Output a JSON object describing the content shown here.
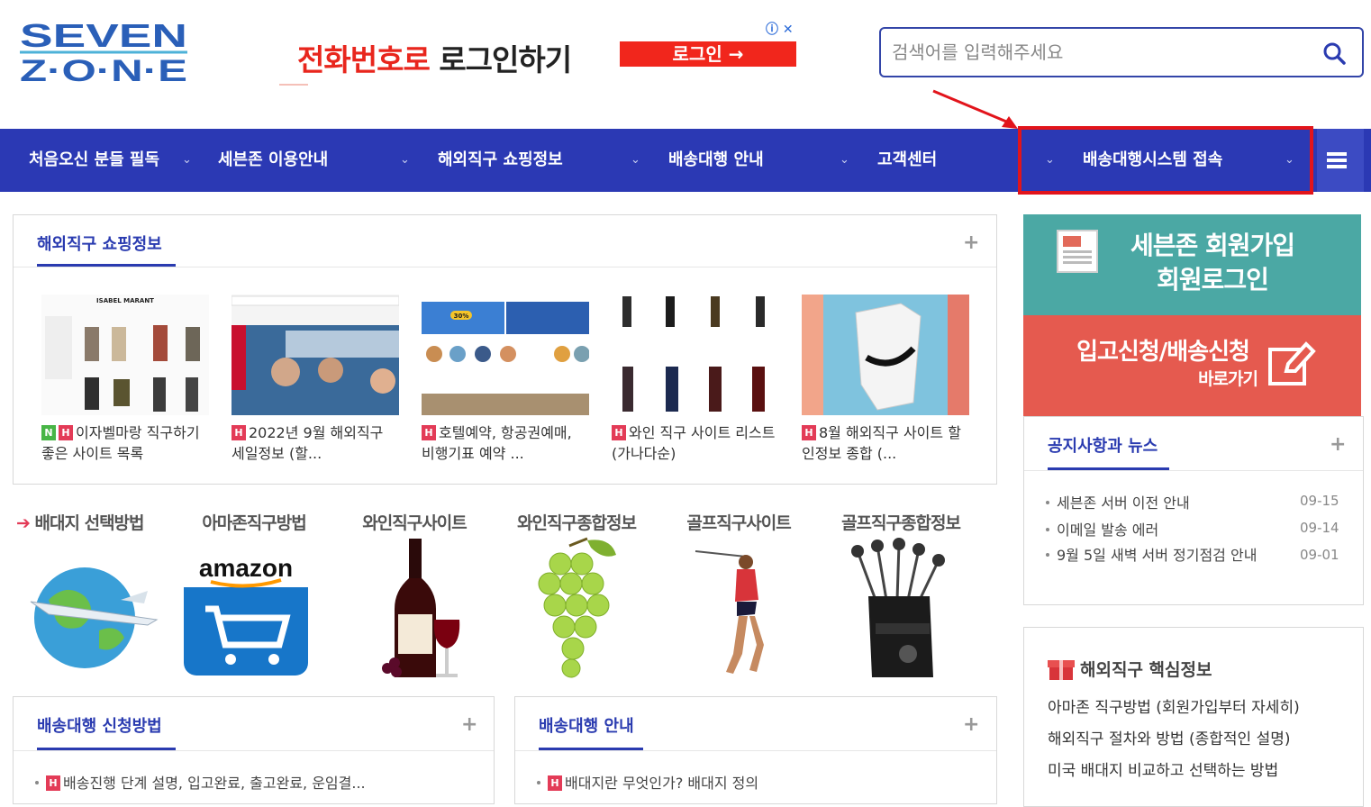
{
  "header": {
    "logo_top": "SEVEN",
    "logo_bottom": "Z·O·N·E",
    "ad_text_red": "전화번호로",
    "ad_text_dark": "로그인하기",
    "ad_button": "로그인 →",
    "search_placeholder": "검색어를 입력해주세요"
  },
  "nav": {
    "items": [
      {
        "label": "처음오신 분들 필독"
      },
      {
        "label": "세븐존 이용안내"
      },
      {
        "label": "해외직구 쇼핑정보"
      },
      {
        "label": "배송대행 안내"
      },
      {
        "label": "고객센터"
      },
      {
        "label": "배송대행시스템 접속"
      }
    ],
    "caret": "⌄",
    "colors": {
      "bar": "#2b39b4",
      "highlight": "#e2141b"
    }
  },
  "shopping": {
    "title": "해외직구 쇼핑정보",
    "plus": "+",
    "posts": [
      {
        "badges": [
          "N",
          "H"
        ],
        "caption": "이자벨마랑 직구하기 좋은 사이트 목록",
        "thumb_label": "ISABEL MARANT"
      },
      {
        "badges": [
          "H"
        ],
        "caption": "2022년 9월 해외직구 세일정보 (할...",
        "thumb_label": ""
      },
      {
        "badges": [
          "H"
        ],
        "caption": "호텔예약, 항공권예매, 비행기표 예약 ...",
        "thumb_label": "30%"
      },
      {
        "badges": [
          "H"
        ],
        "caption": "와인 직구 사이트 리스트 (가나다순)",
        "thumb_label": ""
      },
      {
        "badges": [
          "H"
        ],
        "caption": "8월 해외직구 사이트 할인정보 종합 (...",
        "thumb_label": ""
      }
    ]
  },
  "categories": [
    {
      "label": "배대지 선택방법",
      "icon": "globe-plane-icon"
    },
    {
      "label": "아마존직구방법",
      "icon": "amazon-cart-icon",
      "brand": "amazon"
    },
    {
      "label": "와인직구사이트",
      "icon": "wine-bottle-icon"
    },
    {
      "label": "와인직구종합정보",
      "icon": "grapes-icon"
    },
    {
      "label": "골프직구사이트",
      "icon": "golfer-icon"
    },
    {
      "label": "골프직구종합정보",
      "icon": "golf-bag-icon"
    }
  ],
  "apply": {
    "title": "배송대행 신청방법",
    "plus": "+",
    "items": [
      {
        "badge": "H",
        "text": "배송진행 단계 설명, 입고완료, 출고완료, 운임결..."
      }
    ]
  },
  "guide": {
    "title": "배송대행 안내",
    "plus": "+",
    "items": [
      {
        "badge": "H",
        "text": "배대지란 무엇인가? 배대지 정의"
      }
    ]
  },
  "side": {
    "teal_line1": "세븐존 회원가입",
    "teal_line2": "회원로그인",
    "red_line1": "입고신청/배송신청",
    "red_line2": "바로가기",
    "notice_title": "공지사항과 뉴스",
    "notice_plus": "+",
    "notices": [
      {
        "text": "세븐존 서버 이전 안내",
        "date": "09-15"
      },
      {
        "text": "이메일 발송 에러",
        "date": "09-14"
      },
      {
        "text": "9월 5일 새벽 서버 정기점검 안내",
        "date": "09-01"
      }
    ],
    "core_title": "해외직구 핵심정보",
    "core_links": [
      "아마존 직구방법 (회원가입부터 자세히)",
      "해외직구 절차와 방법 (종합적인 설명)",
      "미국 배대지 비교하고 선택하는 방법"
    ]
  }
}
